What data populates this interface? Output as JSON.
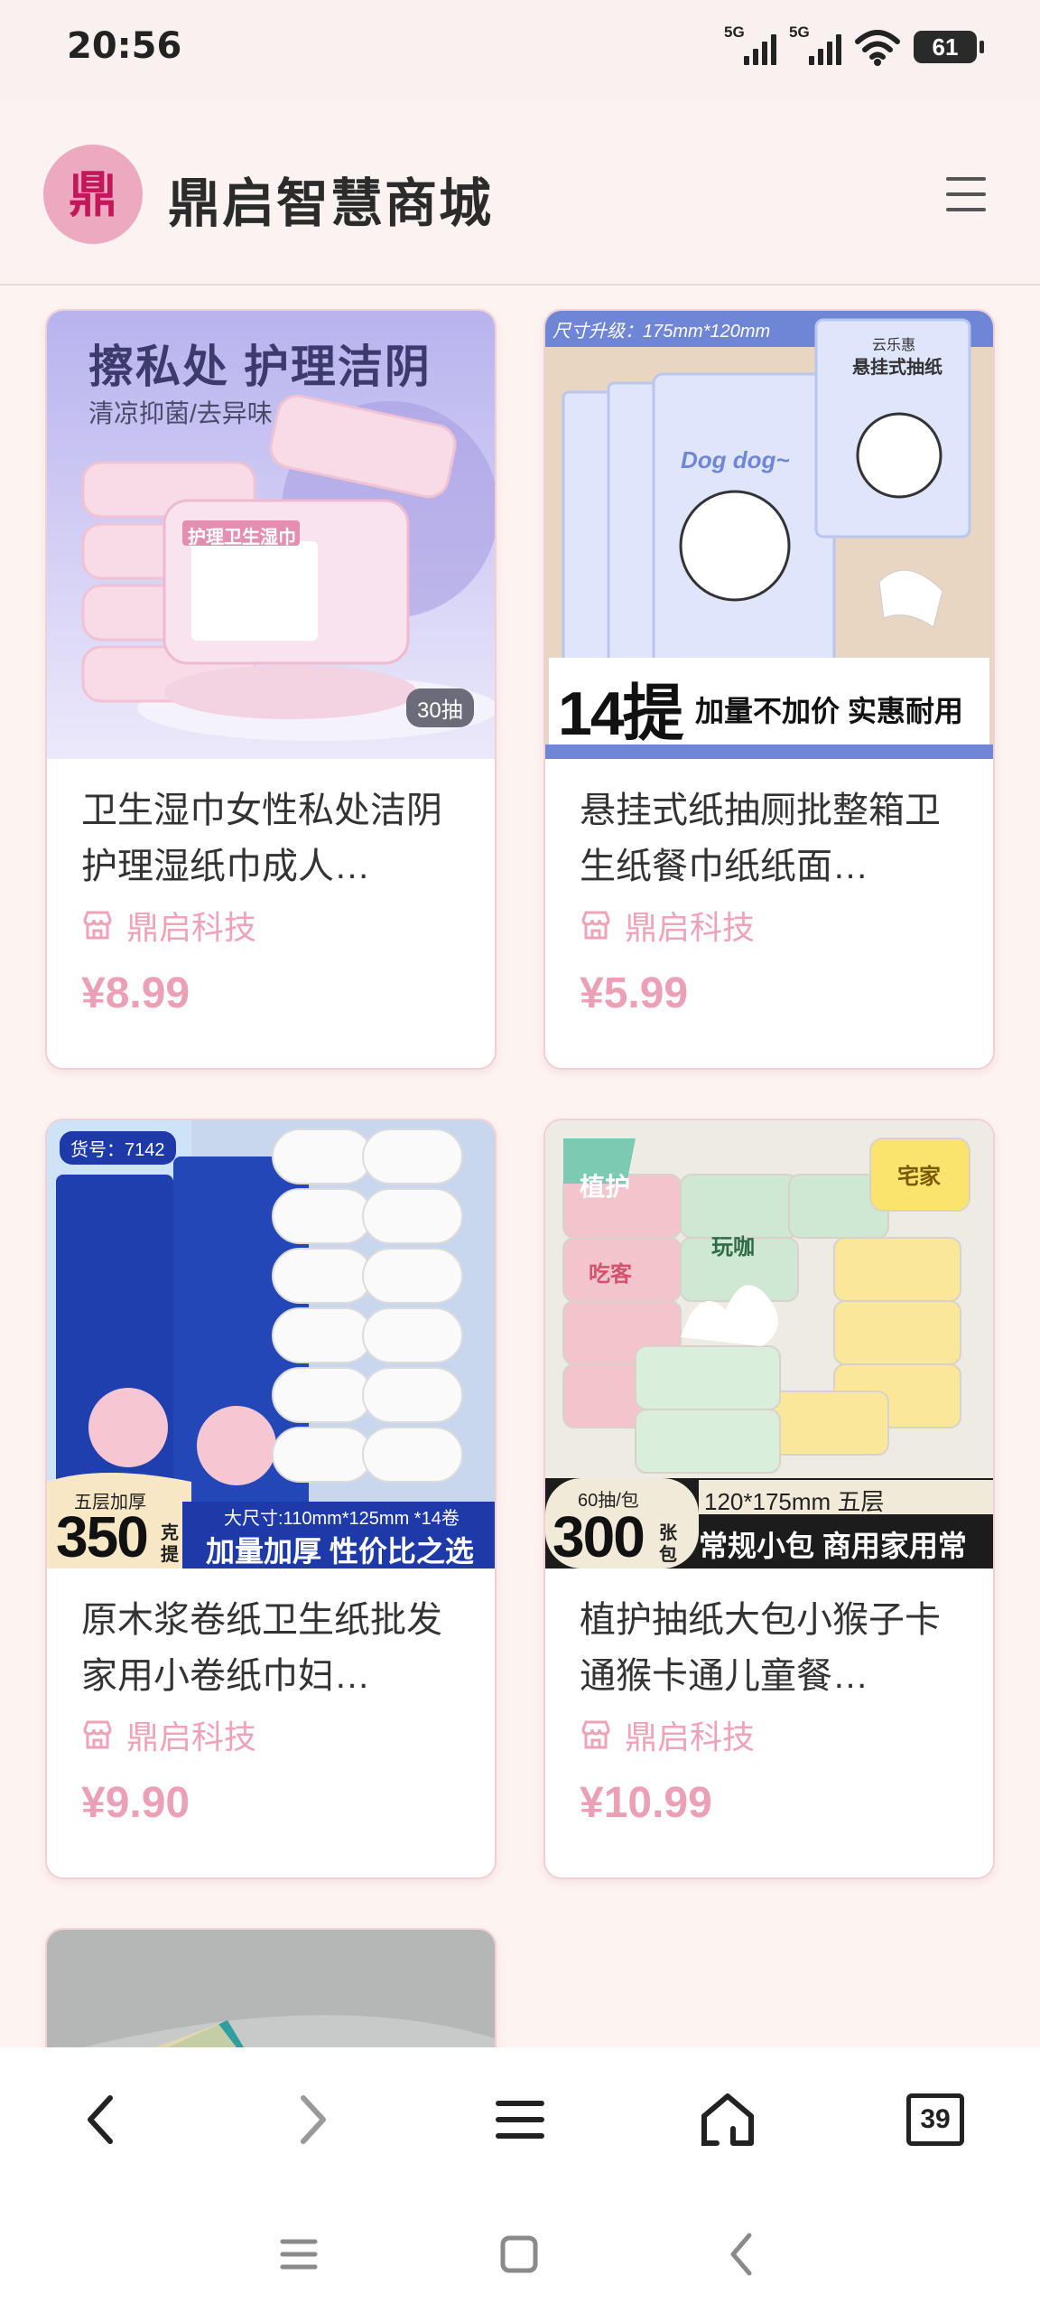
{
  "status": {
    "time": "20:56",
    "sim1": "5G",
    "sim2": "5G",
    "battery": "61"
  },
  "header": {
    "logo_text": "鼎",
    "title": "鼎启智慧商城"
  },
  "products": [
    {
      "title": "卫生湿巾女性私处洁阴护理湿纸巾成人…",
      "shop": "鼎启科技",
      "price": "¥8.99",
      "image": {
        "headline": "擦私处 护理洁阴",
        "sub": "清凉抑菌/去异味",
        "pack_label": "护理卫生湿巾",
        "badge": "30抽"
      }
    },
    {
      "title": "悬挂式纸抽厕批整箱卫生纸餐巾纸纸面…",
      "shop": "鼎启科技",
      "price": "¥5.99",
      "image": {
        "top_tag": "尺寸升级：175mm*120mm",
        "brand": "云乐惠",
        "pack_label": "悬挂式抽纸",
        "dog_text": "Dog dog~",
        "big": "14提",
        "slogan": "加量不加价 实惠耐用"
      }
    },
    {
      "title": "原木浆卷纸卫生纸批发家用小卷纸巾妇…",
      "shop": "鼎启科技",
      "price": "¥9.90",
      "image": {
        "tag": "货号：7142",
        "layer": "五层加厚",
        "big": "350",
        "unit_top": "克",
        "unit_bottom": "提",
        "size": "大尺寸:110mm*125mm *14卷",
        "slogan": "加量加厚 性价比之选"
      }
    },
    {
      "title": "植护抽纸大包小猴子卡通猴卡通儿童餐…",
      "shop": "鼎启科技",
      "price": "¥10.99",
      "image": {
        "brand": "植护",
        "count": "60抽/包",
        "big": "300",
        "unit_top": "张",
        "unit_bottom": "包",
        "size": "120*175mm 五层",
        "slogan": "常规小包 商用家用常备",
        "pack_a": "吃客",
        "pack_b": "玩咖",
        "pack_c": "宅家"
      }
    }
  ],
  "browser_nav": {
    "tab_count": "39"
  },
  "colors": {
    "accent_pink": "#eba0b6",
    "page_bg": "#fdf4f1",
    "card_border": "#f0cfd6"
  }
}
